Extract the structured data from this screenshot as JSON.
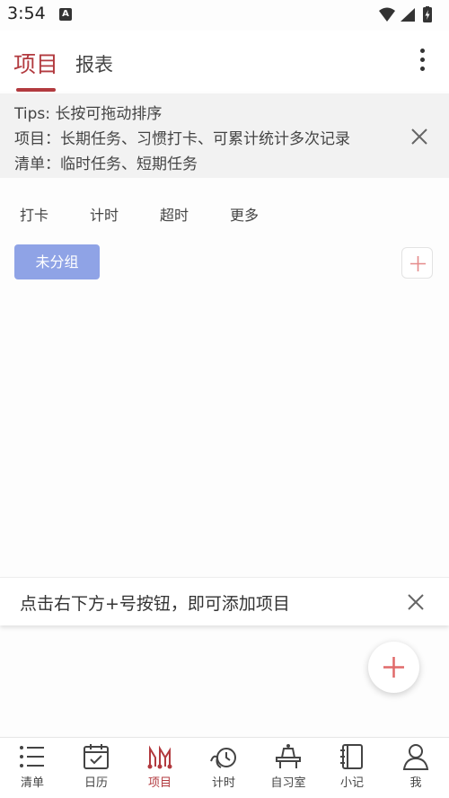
{
  "status_bar": {
    "time": "3:54",
    "a_icon": "A"
  },
  "top_tabs": {
    "project": "项目",
    "report": "报表"
  },
  "tips": {
    "line1": "Tips: 长按可拖动排序",
    "line2": "项目：长期任务、习惯打卡、可累计统计多次记录",
    "line3": "清单：临时任务、短期任务"
  },
  "filters": [
    "打卡",
    "计时",
    "超时",
    "更多"
  ],
  "group": {
    "name": "未分组"
  },
  "hint": {
    "text": "点击右下方+号按钮，即可添加项目"
  },
  "bottom_nav": {
    "items": [
      {
        "label": "清单",
        "icon": "list-icon"
      },
      {
        "label": "日历",
        "icon": "calendar-icon"
      },
      {
        "label": "项目",
        "icon": "project-icon",
        "active": true
      },
      {
        "label": "计时",
        "icon": "timer-icon"
      },
      {
        "label": "自习室",
        "icon": "study-room-icon"
      },
      {
        "label": "小记",
        "icon": "notebook-icon"
      },
      {
        "label": "我",
        "icon": "profile-icon"
      }
    ]
  },
  "colors": {
    "accent": "#b23a3f",
    "group_chip": "#8fa3e6",
    "tips_bg": "#f2f2f2",
    "fab_plus": "#e06a6a"
  }
}
